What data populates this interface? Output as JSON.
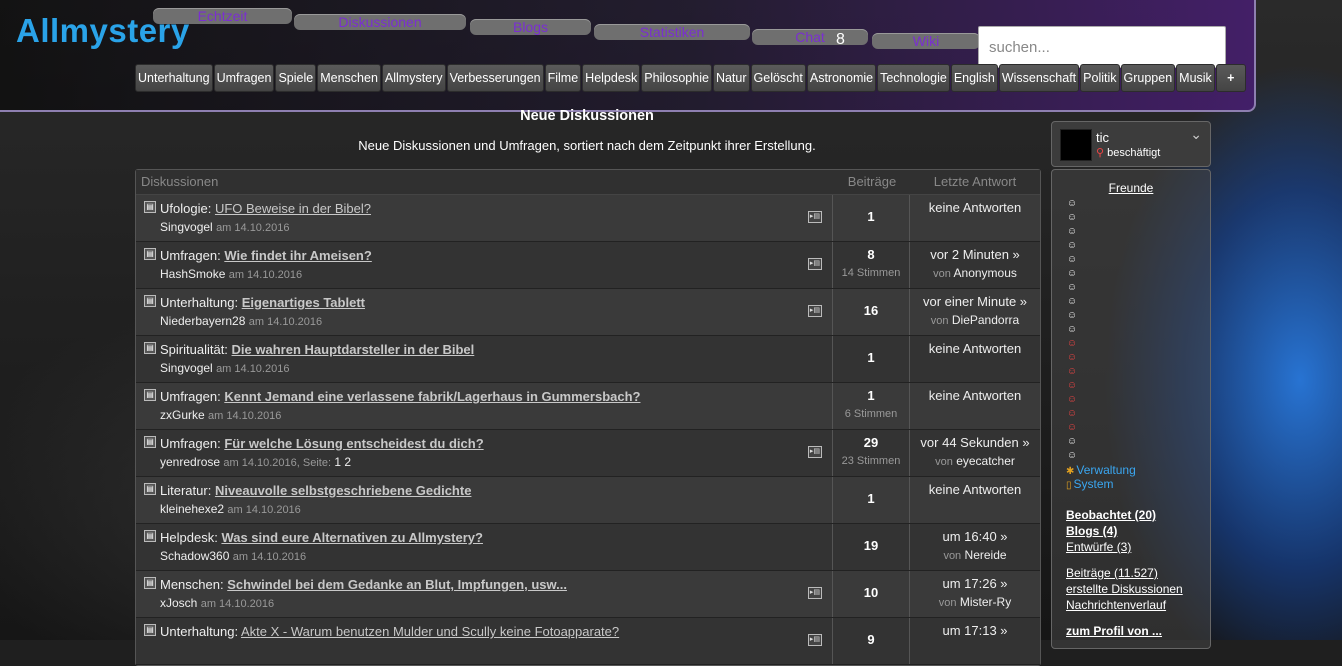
{
  "site": {
    "logo": "Allmystery"
  },
  "nav": {
    "tabs": [
      {
        "label": "Echtzeit"
      },
      {
        "label": "Diskussionen"
      },
      {
        "label": "Blogs"
      },
      {
        "label": "Statistiken"
      },
      {
        "label": "Chat"
      },
      {
        "label": "Wiki"
      }
    ],
    "chat_count": "8"
  },
  "search": {
    "placeholder": "suchen..."
  },
  "categories": [
    "Unterhaltung",
    "Umfragen",
    "Spiele",
    "Menschen",
    "Allmystery",
    "Verbesserungen",
    "Filme",
    "Helpdesk",
    "Philosophie",
    "Natur",
    "Gelöscht",
    "Astronomie",
    "Technologie",
    "English",
    "Wissenschaft",
    "Politik",
    "Gruppen",
    "Musik",
    "+"
  ],
  "main": {
    "title": "Neue Diskussionen",
    "subtitle": "Neue Diskussionen und Umfragen, sortiert nach dem Zeitpunkt ihrer Erstellung."
  },
  "table": {
    "headers": {
      "discussions": "Diskussionen",
      "posts": "Beiträge",
      "last": "Letzte Antwort"
    },
    "rows": [
      {
        "cat": "Ufologie:",
        "title": "UFO Beweise in der Bibel?",
        "author": "Singvogel",
        "date": "am 14.10.2016",
        "pages": "",
        "posts": "1",
        "votes": "",
        "last": "keine Antworten",
        "last_by_prefix": "",
        "last_by": ""
      },
      {
        "cat": "Umfragen:",
        "title": "Wie findet ihr Ameisen?",
        "author": "HashSmoke",
        "date": "am 14.10.2016",
        "pages": "",
        "posts": "8",
        "votes": "14 Stimmen",
        "last": "vor 2 Minuten »",
        "last_by_prefix": "von",
        "last_by": "Anonymous"
      },
      {
        "cat": "Unterhaltung:",
        "title": "Eigenartiges Tablett",
        "author": "Niederbayern28",
        "date": "am 14.10.2016",
        "pages": "",
        "posts": "16",
        "votes": "",
        "last": "vor einer Minute »",
        "last_by_prefix": "von",
        "last_by": "DiePandorra"
      },
      {
        "cat": "Spiritualität:",
        "title": "Die wahren Hauptdarsteller in der Bibel",
        "author": "Singvogel",
        "date": "am 14.10.2016",
        "pages": "",
        "posts": "1",
        "votes": "",
        "last": "keine Antworten",
        "last_by_prefix": "",
        "last_by": ""
      },
      {
        "cat": "Umfragen:",
        "title": "Kennt Jemand eine verlassene fabrik/Lagerhaus in Gummersbach?",
        "author": "zxGurke",
        "date": "am 14.10.2016",
        "pages": "",
        "posts": "1",
        "votes": "6 Stimmen",
        "last": "keine Antworten",
        "last_by_prefix": "",
        "last_by": ""
      },
      {
        "cat": "Umfragen:",
        "title": "Für welche Lösung entscheidest du dich?",
        "author": "yenredrose",
        "date": "am 14.10.2016, Seite:",
        "pages": "1 2",
        "posts": "29",
        "votes": "23 Stimmen",
        "last": "vor 44 Sekunden »",
        "last_by_prefix": "von",
        "last_by": "eyecatcher"
      },
      {
        "cat": "Literatur:",
        "title": "Niveauvolle selbstgeschriebene Gedichte",
        "author": "kleinehexe2",
        "date": "am 14.10.2016",
        "pages": "",
        "posts": "1",
        "votes": "",
        "last": "keine Antworten",
        "last_by_prefix": "",
        "last_by": ""
      },
      {
        "cat": "Helpdesk:",
        "title": "Was sind eure Alternativen zu Allmystery?",
        "author": "Schadow360",
        "date": "am 14.10.2016",
        "pages": "",
        "posts": "19",
        "votes": "",
        "last": "um 16:40 »",
        "last_by_prefix": "von",
        "last_by": "Nereide"
      },
      {
        "cat": "Menschen:",
        "title": "Schwindel bei dem Gedanke an Blut, Impfungen, usw...",
        "author": "xJosch",
        "date": "am 14.10.2016",
        "pages": "",
        "posts": "10",
        "votes": "",
        "last": "um 17:26 »",
        "last_by_prefix": "von",
        "last_by": "Mister-Ry"
      },
      {
        "cat": "Unterhaltung:",
        "title": "Akte X - Warum benutzen Mulder und Scully keine Fotoapparate?",
        "author": "",
        "date": "",
        "pages": "",
        "posts": "9",
        "votes": "",
        "last": "um 17:13 »",
        "last_by_prefix": "",
        "last_by": ""
      }
    ]
  },
  "user": {
    "name": "tic",
    "status": "beschäftigt"
  },
  "sidebar": {
    "friends_title": "Freunde",
    "verwaltung": "Verwaltung",
    "system": "System",
    "links": {
      "beobachtet": "Beobachtet (20)",
      "blogs": "Blogs (4)",
      "entwuerfe": "Entwürfe (3)",
      "beitraege": "Beiträge (11.527)",
      "erstellte": "erstellte Diskussionen",
      "verlauf": "Nachrichtenverlauf",
      "profil": "zum Profil von ..."
    }
  },
  "colors": {
    "logo": "#2aa3e8",
    "tab_text": "#7a2fd0",
    "link_blue": "#3aa6f0",
    "online_red": "#e44444"
  }
}
